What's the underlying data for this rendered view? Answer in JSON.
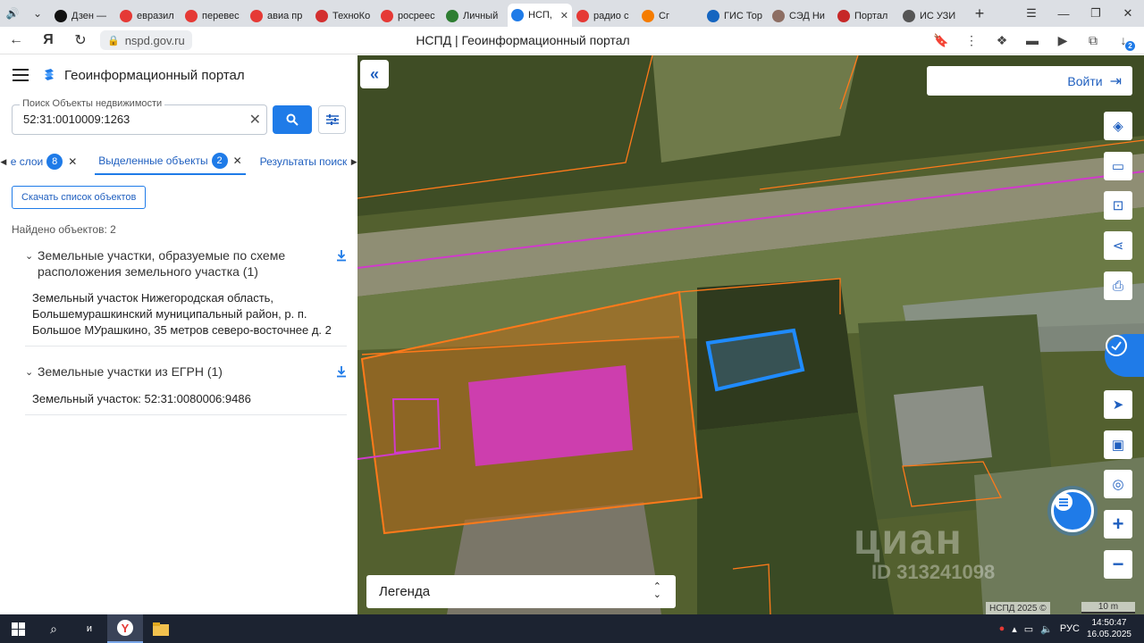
{
  "browser": {
    "tabs": [
      {
        "title": "Дзен —",
        "color": "#111111"
      },
      {
        "title": "евразил",
        "color": "#e53935"
      },
      {
        "title": "перевес",
        "color": "#e53935"
      },
      {
        "title": "авиа пр",
        "color": "#e53935"
      },
      {
        "title": "ТехноКо",
        "color": "#d32f2f"
      },
      {
        "title": "росреес",
        "color": "#e53935"
      },
      {
        "title": "Личный",
        "color": "#2e7d32"
      },
      {
        "title": "НСП,",
        "color": "#1f7be8",
        "active": true
      },
      {
        "title": "радио с",
        "color": "#e53935"
      },
      {
        "title": "Сг",
        "color": "#f57c00"
      },
      {
        "title": "ГИС Тор",
        "color": "#1565c0"
      },
      {
        "title": "СЭД Ни",
        "color": "#8d6e63"
      },
      {
        "title": "Портал",
        "color": "#c62828"
      },
      {
        "title": "ИС УЗИ",
        "color": "#555555"
      }
    ],
    "url": "nspd.gov.ru",
    "page_title": "НСПД | Геоинформационный портал",
    "downloads_count": "2"
  },
  "panel": {
    "title": "Геоинформационный портал",
    "search_label": "Поиск Объекты недвижимости",
    "search_value": "52:31:0010009:1263",
    "tabs": [
      {
        "label": "е слои",
        "badge": "8"
      },
      {
        "label": "Выделенные объекты",
        "badge": "2"
      },
      {
        "label": "Результаты поиск"
      }
    ],
    "download_list": "Скачать список объектов",
    "found": "Найдено объектов: 2",
    "groups": [
      {
        "title": "Земельные участки, образуемые по схеме расположения земельного участка (1)",
        "item": "Земельный участок Нижегородская область, Большемурашкинский муниципальный район, р. п. Большое МУрашкино, 35 метров северо-восточнее д. 2"
      },
      {
        "title": "Земельные участки из ЕГРН (1)",
        "item": "Земельный участок: 52:31:0080006:9486"
      }
    ]
  },
  "map": {
    "login": "Войти",
    "legend": "Легенда",
    "attribution": "НСПД 2025 ©",
    "scale": "10 m",
    "watermark": "циан",
    "watermark_id": "ID 313241098"
  },
  "taskbar": {
    "lang": "РУС",
    "time": "14:50:47",
    "date": "16.05.2025"
  }
}
